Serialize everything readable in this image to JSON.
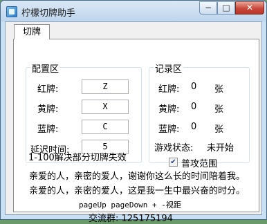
{
  "window": {
    "title": "柠檬切牌助手",
    "minimize_label": "−",
    "maximize_label": "□",
    "close_label": "✕"
  },
  "tab": {
    "label": "切牌"
  },
  "config": {
    "group_title": "配置区",
    "red_label": "红牌:",
    "red_value": "Z",
    "yellow_label": "黄牌:",
    "yellow_value": "X",
    "blue_label": "蓝牌:",
    "blue_value": "C",
    "delay_label": "延迟时间:",
    "delay_value": "5",
    "hint": "1-100解决部分切牌失效"
  },
  "record": {
    "group_title": "记录区",
    "red_label": "红牌:",
    "red_count": "0",
    "yellow_label": "黄牌:",
    "yellow_count": "0",
    "blue_label": "蓝牌:",
    "blue_count": "0",
    "unit": "张",
    "status_label": "游戏状态:",
    "status_value": "未开始",
    "checkbox_label": "普攻范围",
    "checkbox_checked": true
  },
  "footer": {
    "line1": "亲爱的人，亲密的爱人，谢谢你这么长的时间陪着我。",
    "line2": "亲爱的人，亲密的爱人，这是我一生中最兴奋的时分。",
    "line3": "pageUp pageDown + -视距",
    "line4": "交流群: 125175194"
  }
}
